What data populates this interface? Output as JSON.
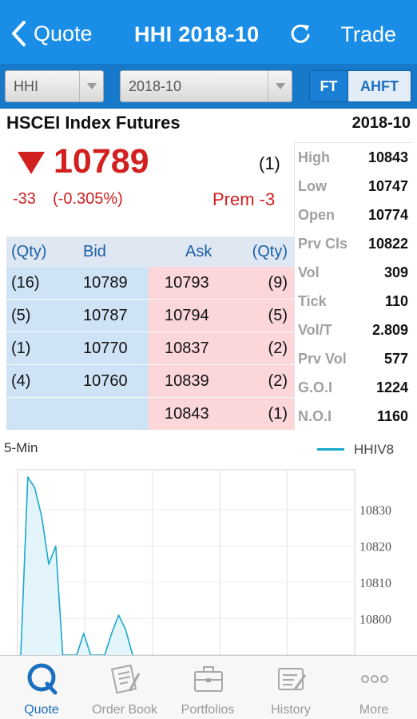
{
  "nav": {
    "back_label": "Quote",
    "title": "HHI 2018-10",
    "trade_label": "Trade"
  },
  "selectors": {
    "symbol": "HHI",
    "month": "2018-10",
    "segment_ft": "FT",
    "segment_ahft": "AHFT",
    "segment_selected": "FT"
  },
  "instrument": {
    "name": "HSCEI Index Futures",
    "month": "2018-10"
  },
  "price": {
    "last": "10789",
    "last_qty": "(1)",
    "change": "-33",
    "change_pct": "(-0.305%)",
    "premium": "Prem -3",
    "direction": "down",
    "color": "#d21f1f"
  },
  "order_book": {
    "headers": {
      "bid_qty": "(Qty)",
      "bid": "Bid",
      "ask": "Ask",
      "ask_qty": "(Qty)"
    },
    "rows": [
      {
        "bid_qty": "(16)",
        "bid": "10789",
        "ask": "10793",
        "ask_qty": "(9)"
      },
      {
        "bid_qty": "(5)",
        "bid": "10787",
        "ask": "10794",
        "ask_qty": "(5)"
      },
      {
        "bid_qty": "(1)",
        "bid": "10770",
        "ask": "10837",
        "ask_qty": "(2)"
      },
      {
        "bid_qty": "(4)",
        "bid": "10760",
        "ask": "10839",
        "ask_qty": "(2)"
      },
      {
        "bid_qty": "",
        "bid": "",
        "ask": "10843",
        "ask_qty": "(1)"
      }
    ],
    "bid_color": "#cfe3f6",
    "ask_color": "#fbd7da"
  },
  "stats": [
    {
      "label": "High",
      "value": "10843"
    },
    {
      "label": "Low",
      "value": "10747"
    },
    {
      "label": "Open",
      "value": "10774"
    },
    {
      "label": "Prv Cls",
      "value": "10822"
    },
    {
      "label": "Vol",
      "value": "309"
    },
    {
      "label": "Tick",
      "value": "110"
    },
    {
      "label": "Vol/T",
      "value": "2.809"
    },
    {
      "label": "Prv Vol",
      "value": "577"
    },
    {
      "label": "G.O.I",
      "value": "1224"
    },
    {
      "label": "N.O.I",
      "value": "1160"
    }
  ],
  "chart": {
    "interval_label": "5-Min",
    "legend": "HHIV8",
    "line_color": "#1aa8cc",
    "y_ticks": [
      "10830",
      "10820",
      "10810",
      "10800"
    ]
  },
  "chart_data": {
    "type": "line",
    "title": "",
    "xlabel": "",
    "ylabel": "",
    "ylim": [
      10790,
      10841
    ],
    "series": [
      {
        "name": "HHIV8",
        "values": [
          10790,
          10839,
          10836,
          10828,
          10815,
          10820,
          10790,
          10790,
          10790,
          10796,
          10790,
          10790,
          10790,
          10796,
          10801,
          10797,
          10790
        ]
      }
    ],
    "grid": true
  },
  "tabs": [
    {
      "label": "Quote",
      "icon": "quote-icon",
      "active": true
    },
    {
      "label": "Order Book",
      "icon": "order-book-icon",
      "active": false
    },
    {
      "label": "Portfolios",
      "icon": "briefcase-icon",
      "active": false
    },
    {
      "label": "History",
      "icon": "history-icon",
      "active": false
    },
    {
      "label": "More",
      "icon": "more-icon",
      "active": false
    }
  ]
}
